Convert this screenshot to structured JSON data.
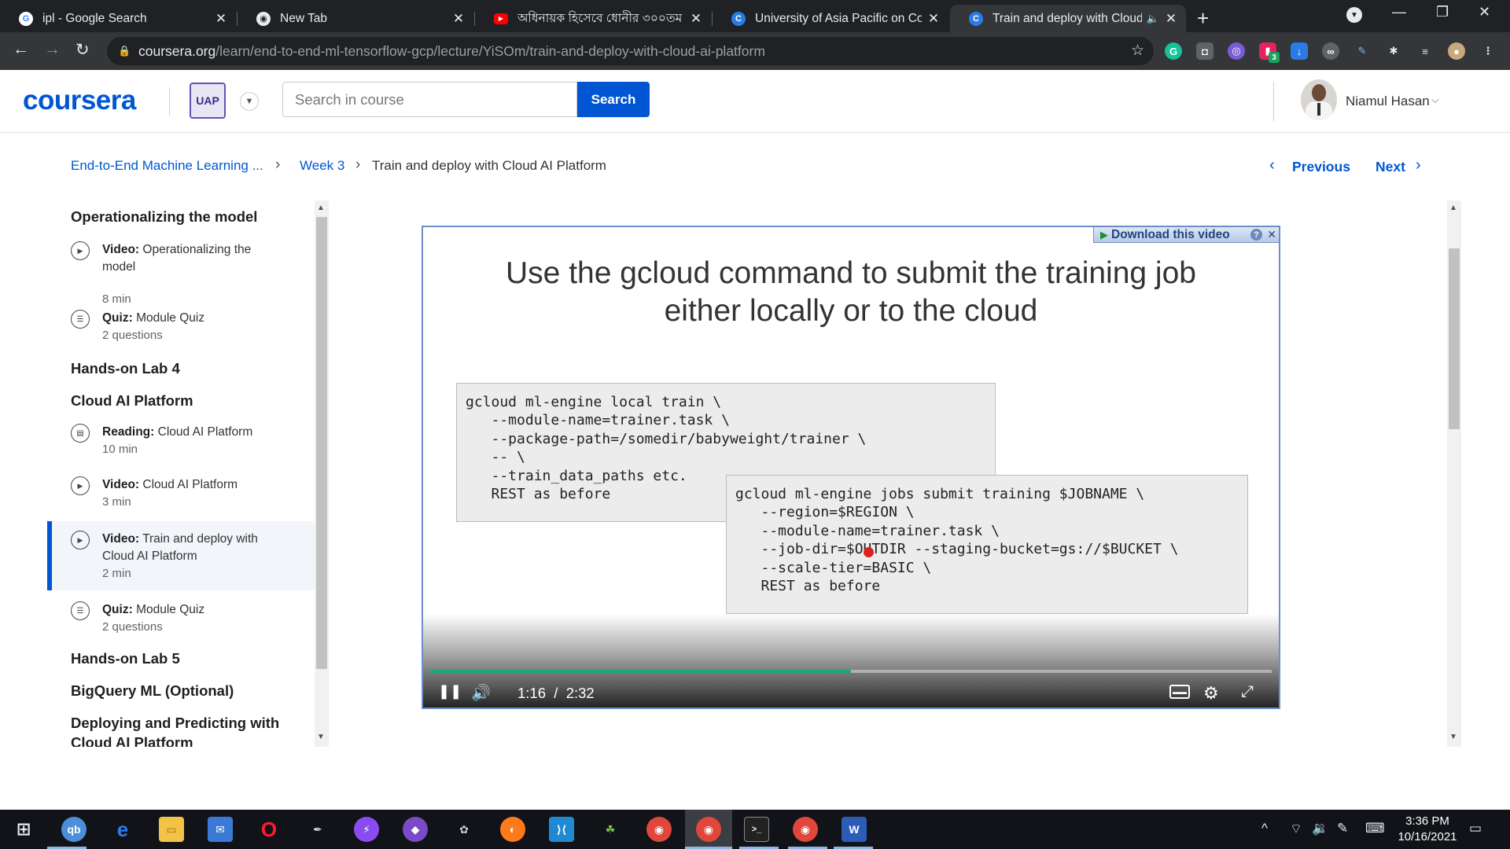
{
  "browser": {
    "tabs": [
      {
        "title": "ipl - Google Search",
        "active": false
      },
      {
        "title": "New Tab",
        "active": false
      },
      {
        "title": "অধিনায়ক হিসেবে ধোনীর ৩০০তম",
        "active": false
      },
      {
        "title": "University of Asia Pacific on Cour",
        "active": false
      },
      {
        "title": "Train and deploy with Cloud",
        "active": true
      }
    ],
    "url_host": "coursera.org",
    "url_path": "/learn/end-to-end-ml-tensorflow-gcp/lecture/YiSOm/train-and-deploy-with-cloud-ai-platform",
    "extension_badge": "3"
  },
  "header": {
    "logo": "coursera",
    "search_placeholder": "Search in course",
    "search_button": "Search",
    "user_name": "Niamul Hasan"
  },
  "breadcrumb": {
    "course": "End-to-End Machine Learning ...",
    "week": "Week 3",
    "current": "Train and deploy with Cloud AI Platform",
    "previous": "Previous",
    "next": "Next"
  },
  "sidebar": {
    "sec_operationalizing": "Operationalizing the model",
    "sec_lab4": "Hands-on Lab 4",
    "sec_cloud_ai": "Cloud AI Platform",
    "sec_lab5": "Hands-on Lab 5",
    "sec_bqml": "BigQuery ML (Optional)",
    "sec_deploying_1": "Deploying and Predicting with",
    "sec_deploying_2": "Cloud AI Platform",
    "items": [
      {
        "type": "Video:",
        "title": "Operationalizing the model",
        "meta": "8 min"
      },
      {
        "type": "Quiz:",
        "title": "Module Quiz",
        "meta": "2 questions"
      },
      {
        "type": "Reading:",
        "title": "Cloud AI Platform",
        "meta": "10 min"
      },
      {
        "type": "Video:",
        "title": "Cloud AI Platform",
        "meta": "3 min"
      },
      {
        "type": "Video:",
        "title": "Train and deploy with Cloud AI Platform",
        "meta": "2 min"
      },
      {
        "type": "Quiz:",
        "title": "Module Quiz",
        "meta": "2 questions"
      }
    ]
  },
  "video": {
    "slide_title": "Use the gcloud command to submit the training job either locally or to the cloud",
    "code_local": "gcloud ml-engine local train \\\n   --module-name=trainer.task \\\n   --package-path=/somedir/babyweight/trainer \\\n   -- \\\n   --train_data_paths etc.\n   REST as before",
    "code_cloud": "gcloud ml-engine jobs submit training $JOBNAME \\\n   --region=$REGION \\\n   --module-name=trainer.task \\\n   --job-dir=$OUTDIR --staging-bucket=gs://$BUCKET \\\n   --scale-tier=BASIC \\\n   REST as before",
    "current_time": "1:16",
    "duration": "2:32",
    "progress_fraction": 0.5,
    "download_label": "Download this video",
    "progress_color": "#21a67a"
  },
  "taskbar": {
    "time": "3:36 PM",
    "date": "10/16/2021"
  },
  "colors": {
    "brand": "#0056d2",
    "chrome_dark": "#202124",
    "chrome_toolbar": "#35363a",
    "taskbar": "#111318"
  }
}
